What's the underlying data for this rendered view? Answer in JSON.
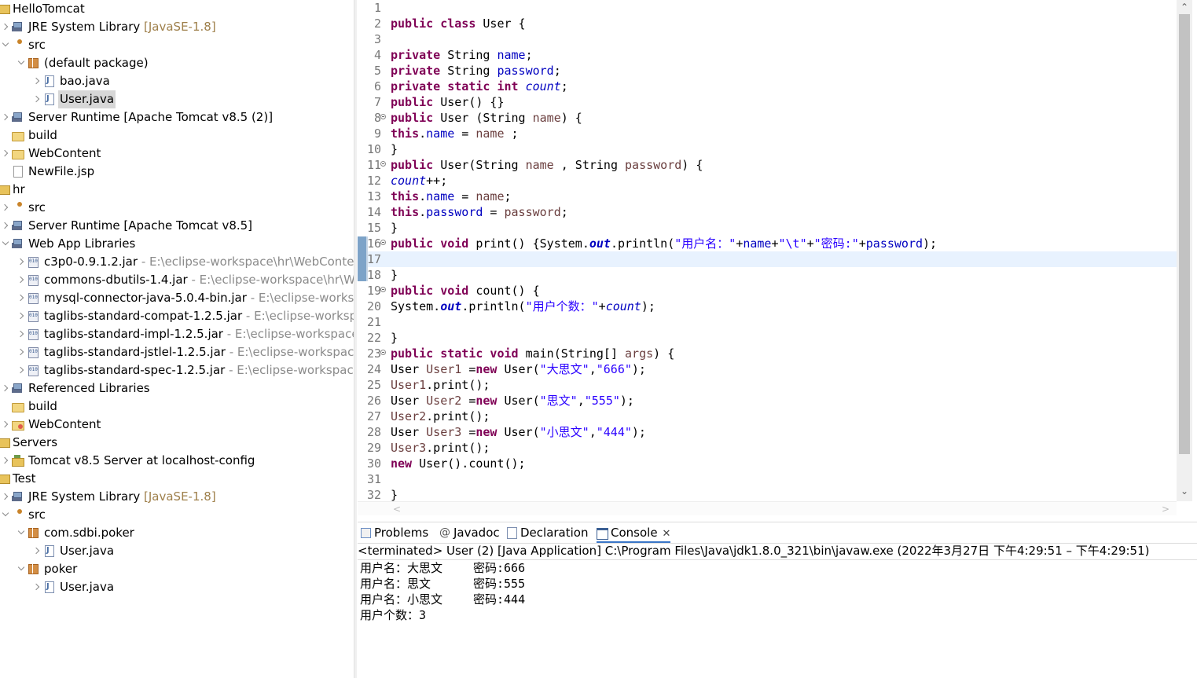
{
  "explorer": {
    "rows": [
      {
        "label": "HelloTomcat",
        "extra": "",
        "arrow": "none",
        "icon": "proj",
        "depth": 0
      },
      {
        "label": "JRE System Library",
        "extra": "[JavaSE-1.8]",
        "extraType": "lib",
        "arrow": "closed",
        "icon": "lib",
        "depth": 1
      },
      {
        "label": "src",
        "extra": "",
        "arrow": "open",
        "icon": "src",
        "depth": 1
      },
      {
        "label": "(default package)",
        "extra": "",
        "arrow": "open",
        "icon": "pkg",
        "depth": 2
      },
      {
        "label": "bao.java",
        "extra": "",
        "arrow": "closed",
        "icon": "java",
        "depth": 3
      },
      {
        "label": "User.java",
        "extra": "",
        "arrow": "closed",
        "icon": "java",
        "depth": 3,
        "selected": true
      },
      {
        "label": "Server Runtime [Apache Tomcat v8.5 (2)]",
        "extra": "",
        "arrow": "closed",
        "icon": "lib",
        "depth": 1
      },
      {
        "label": "build",
        "extra": "",
        "arrow": "none",
        "icon": "folder",
        "depth": 1
      },
      {
        "label": "WebContent",
        "extra": "",
        "arrow": "closed",
        "icon": "folder",
        "depth": 1
      },
      {
        "label": "NewFile.jsp",
        "extra": "",
        "arrow": "none",
        "icon": "file",
        "depth": 1
      },
      {
        "label": "hr",
        "extra": "",
        "arrow": "none",
        "icon": "proj",
        "depth": 0
      },
      {
        "label": "src",
        "extra": "",
        "arrow": "closed",
        "icon": "src",
        "depth": 1
      },
      {
        "label": "Server Runtime [Apache Tomcat v8.5]",
        "extra": "",
        "arrow": "closed",
        "icon": "lib",
        "depth": 1
      },
      {
        "label": "Web App Libraries",
        "extra": "",
        "arrow": "open",
        "icon": "lib",
        "depth": 1
      },
      {
        "label": "c3p0-0.9.1.2.jar",
        "extra": "- E:\\eclipse-workspace\\hr\\WebContent",
        "extraType": "muted",
        "arrow": "closed",
        "icon": "jar",
        "depth": 2
      },
      {
        "label": "commons-dbutils-1.4.jar",
        "extra": "- E:\\eclipse-workspace\\hr\\We",
        "extraType": "muted",
        "arrow": "closed",
        "icon": "jar",
        "depth": 2
      },
      {
        "label": "mysql-connector-java-5.0.4-bin.jar",
        "extra": "- E:\\eclipse-worksp",
        "extraType": "muted",
        "arrow": "closed",
        "icon": "jar",
        "depth": 2
      },
      {
        "label": "taglibs-standard-compat-1.2.5.jar",
        "extra": "- E:\\eclipse-workspa",
        "extraType": "muted",
        "arrow": "closed",
        "icon": "jar",
        "depth": 2
      },
      {
        "label": "taglibs-standard-impl-1.2.5.jar",
        "extra": "- E:\\eclipse-workspace\\",
        "extraType": "muted",
        "arrow": "closed",
        "icon": "jar",
        "depth": 2
      },
      {
        "label": "taglibs-standard-jstlel-1.2.5.jar",
        "extra": "- E:\\eclipse-workspace\\",
        "extraType": "muted",
        "arrow": "closed",
        "icon": "jar",
        "depth": 2
      },
      {
        "label": "taglibs-standard-spec-1.2.5.jar",
        "extra": "- E:\\eclipse-workspace\\",
        "extraType": "muted",
        "arrow": "closed",
        "icon": "jar",
        "depth": 2
      },
      {
        "label": "Referenced Libraries",
        "extra": "",
        "arrow": "closed",
        "icon": "lib",
        "depth": 1
      },
      {
        "label": "build",
        "extra": "",
        "arrow": "none",
        "icon": "folder",
        "depth": 1
      },
      {
        "label": "WebContent",
        "extra": "",
        "arrow": "closed",
        "icon": "web",
        "depth": 1
      },
      {
        "label": "Servers",
        "extra": "",
        "arrow": "none",
        "icon": "proj",
        "depth": 0
      },
      {
        "label": "Tomcat v8.5 Server at localhost-config",
        "extra": "",
        "arrow": "closed",
        "icon": "server",
        "depth": 1
      },
      {
        "label": "Test",
        "extra": "",
        "arrow": "none",
        "icon": "proj",
        "depth": 0
      },
      {
        "label": "JRE System Library",
        "extra": "[JavaSE-1.8]",
        "extraType": "lib",
        "arrow": "closed",
        "icon": "lib",
        "depth": 1
      },
      {
        "label": "src",
        "extra": "",
        "arrow": "open",
        "icon": "src",
        "depth": 1
      },
      {
        "label": "com.sdbi.poker",
        "extra": "",
        "arrow": "open",
        "icon": "pkg",
        "depth": 2
      },
      {
        "label": "User.java",
        "extra": "",
        "arrow": "closed",
        "icon": "java",
        "depth": 3
      },
      {
        "label": "poker",
        "extra": "",
        "arrow": "open",
        "icon": "pkg",
        "depth": 2
      },
      {
        "label": "User.java",
        "extra": "",
        "arrow": "closed",
        "icon": "java",
        "depth": 3
      }
    ]
  },
  "editor": {
    "current_line": 17,
    "lines": [
      {
        "n": "1",
        "fold": false,
        "tokens": []
      },
      {
        "n": "2",
        "fold": false,
        "tokens": [
          [
            "kw",
            "public class"
          ],
          [
            "pln",
            " User {"
          ]
        ]
      },
      {
        "n": "3",
        "fold": false,
        "tokens": []
      },
      {
        "n": "4",
        "fold": false,
        "tokens": [
          [
            "kw",
            "private"
          ],
          [
            "pln",
            " String "
          ],
          [
            "fld",
            "name"
          ],
          [
            "pln",
            ";"
          ]
        ]
      },
      {
        "n": "5",
        "fold": false,
        "tokens": [
          [
            "kw",
            "private"
          ],
          [
            "pln",
            " String "
          ],
          [
            "fld",
            "password"
          ],
          [
            "pln",
            ";"
          ]
        ]
      },
      {
        "n": "6",
        "fold": false,
        "tokens": [
          [
            "kw",
            "private static int"
          ],
          [
            "pln",
            " "
          ],
          [
            "sfld",
            "count"
          ],
          [
            "pln",
            ";"
          ]
        ]
      },
      {
        "n": "7",
        "fold": false,
        "tokens": [
          [
            "kw",
            "public"
          ],
          [
            "pln",
            " User() {}"
          ]
        ]
      },
      {
        "n": "8",
        "fold": true,
        "tokens": [
          [
            "kw",
            "public"
          ],
          [
            "pln",
            " User (String "
          ],
          [
            "var",
            "name"
          ],
          [
            "pln",
            ") {"
          ]
        ]
      },
      {
        "n": "9",
        "fold": false,
        "tokens": [
          [
            "kw",
            "this"
          ],
          [
            "pln",
            "."
          ],
          [
            "fld",
            "name"
          ],
          [
            "pln",
            " = "
          ],
          [
            "var",
            "name"
          ],
          [
            "pln",
            " ;"
          ]
        ]
      },
      {
        "n": "10",
        "fold": false,
        "tokens": [
          [
            "pln",
            "}"
          ]
        ]
      },
      {
        "n": "11",
        "fold": true,
        "tokens": [
          [
            "kw",
            "public"
          ],
          [
            "pln",
            " User(String "
          ],
          [
            "var",
            "name"
          ],
          [
            "pln",
            " , String "
          ],
          [
            "var",
            "password"
          ],
          [
            "pln",
            ") {"
          ]
        ]
      },
      {
        "n": "12",
        "fold": false,
        "tokens": [
          [
            "sfld",
            "count"
          ],
          [
            "pln",
            "++;"
          ]
        ]
      },
      {
        "n": "13",
        "fold": false,
        "tokens": [
          [
            "kw",
            "this"
          ],
          [
            "pln",
            "."
          ],
          [
            "fld",
            "name"
          ],
          [
            "pln",
            " = "
          ],
          [
            "var",
            "name"
          ],
          [
            "pln",
            ";"
          ]
        ]
      },
      {
        "n": "14",
        "fold": false,
        "tokens": [
          [
            "kw",
            "this"
          ],
          [
            "pln",
            "."
          ],
          [
            "fld",
            "password"
          ],
          [
            "pln",
            " = "
          ],
          [
            "var",
            "password"
          ],
          [
            "pln",
            ";"
          ]
        ]
      },
      {
        "n": "15",
        "fold": false,
        "tokens": [
          [
            "pln",
            "}"
          ]
        ]
      },
      {
        "n": "16",
        "fold": true,
        "tokens": [
          [
            "kw",
            "public void"
          ],
          [
            "pln",
            " print() {System."
          ],
          [
            "sout",
            "out"
          ],
          [
            "pln",
            ".println("
          ],
          [
            "str",
            "\"用户名：\""
          ],
          [
            "pln",
            "+"
          ],
          [
            "fld",
            "name"
          ],
          [
            "pln",
            "+"
          ],
          [
            "str",
            "\"\\t\""
          ],
          [
            "pln",
            "+"
          ],
          [
            "str",
            "\"密码:\""
          ],
          [
            "pln",
            "+"
          ],
          [
            "fld",
            "password"
          ],
          [
            "pln",
            ");"
          ]
        ]
      },
      {
        "n": "17",
        "fold": false,
        "tokens": []
      },
      {
        "n": "18",
        "fold": false,
        "tokens": [
          [
            "pln",
            "}"
          ]
        ]
      },
      {
        "n": "19",
        "fold": true,
        "tokens": [
          [
            "kw",
            "public void"
          ],
          [
            "pln",
            " count() {"
          ]
        ]
      },
      {
        "n": "20",
        "fold": false,
        "tokens": [
          [
            "pln",
            "System."
          ],
          [
            "sout",
            "out"
          ],
          [
            "pln",
            ".println("
          ],
          [
            "str",
            "\"用户个数：\""
          ],
          [
            "pln",
            "+"
          ],
          [
            "sfld",
            "count"
          ],
          [
            "pln",
            ");"
          ]
        ]
      },
      {
        "n": "21",
        "fold": false,
        "tokens": []
      },
      {
        "n": "22",
        "fold": false,
        "tokens": [
          [
            "pln",
            "}"
          ]
        ]
      },
      {
        "n": "23",
        "fold": true,
        "tokens": [
          [
            "kw",
            "public static void"
          ],
          [
            "pln",
            " main(String[] "
          ],
          [
            "var",
            "args"
          ],
          [
            "pln",
            ") {"
          ]
        ]
      },
      {
        "n": "24",
        "fold": false,
        "tokens": [
          [
            "pln",
            "User "
          ],
          [
            "var",
            "User1"
          ],
          [
            "pln",
            " ="
          ],
          [
            "kw",
            "new"
          ],
          [
            "pln",
            " User("
          ],
          [
            "str",
            "\"大思文\""
          ],
          [
            "pln",
            ","
          ],
          [
            "str",
            "\"666\""
          ],
          [
            "pln",
            ");"
          ]
        ]
      },
      {
        "n": "25",
        "fold": false,
        "tokens": [
          [
            "var",
            "User1"
          ],
          [
            "pln",
            ".print();"
          ]
        ]
      },
      {
        "n": "26",
        "fold": false,
        "tokens": [
          [
            "pln",
            "User "
          ],
          [
            "var",
            "User2"
          ],
          [
            "pln",
            " ="
          ],
          [
            "kw",
            "new"
          ],
          [
            "pln",
            " User("
          ],
          [
            "str",
            "\"思文\""
          ],
          [
            "pln",
            ","
          ],
          [
            "str",
            "\"555\""
          ],
          [
            "pln",
            ");"
          ]
        ]
      },
      {
        "n": "27",
        "fold": false,
        "tokens": [
          [
            "var",
            "User2"
          ],
          [
            "pln",
            ".print();"
          ]
        ]
      },
      {
        "n": "28",
        "fold": false,
        "tokens": [
          [
            "pln",
            "User "
          ],
          [
            "var",
            "User3"
          ],
          [
            "pln",
            " ="
          ],
          [
            "kw",
            "new"
          ],
          [
            "pln",
            " User("
          ],
          [
            "str",
            "\"小思文\""
          ],
          [
            "pln",
            ","
          ],
          [
            "str",
            "\"444\""
          ],
          [
            "pln",
            ");"
          ]
        ]
      },
      {
        "n": "29",
        "fold": false,
        "tokens": [
          [
            "var",
            "User3"
          ],
          [
            "pln",
            ".print();"
          ]
        ]
      },
      {
        "n": "30",
        "fold": false,
        "tokens": [
          [
            "kw",
            "new"
          ],
          [
            "pln",
            " User().count();"
          ]
        ]
      },
      {
        "n": "31",
        "fold": false,
        "tokens": []
      },
      {
        "n": "32",
        "fold": false,
        "tokens": [
          [
            "pln",
            "}"
          ]
        ]
      }
    ]
  },
  "scrollbar": {
    "up": "⌃",
    "down": "⌄",
    "left": "<",
    "right": ">"
  },
  "views": {
    "tabs": [
      {
        "label": "Problems",
        "icon": "problems-icon",
        "active": false
      },
      {
        "label": "Javadoc",
        "icon": "javadoc-icon",
        "active": false
      },
      {
        "label": "Declaration",
        "icon": "declaration-icon",
        "active": false
      },
      {
        "label": "Console",
        "icon": "console-icon",
        "active": true,
        "close": "✕"
      }
    ]
  },
  "console": {
    "status": "<terminated> User (2) [Java Application] C:\\Program Files\\Java\\jdk1.8.0_321\\bin\\javaw.exe  (2022年3月27日 下午4:29:51 – 下午4:29:51)",
    "output": [
      "用户名：大思文\t密码:666",
      "用户名：思文\t密码:555",
      "用户名：小思文\t密码:444",
      "用户个数：3"
    ]
  },
  "colors": {
    "keyword": "#7f0055",
    "field": "#0000c0",
    "string": "#2a00ff",
    "variable": "#6a3e3e",
    "current_line": "#e8f2fe",
    "selection": "#d7d7d7"
  }
}
